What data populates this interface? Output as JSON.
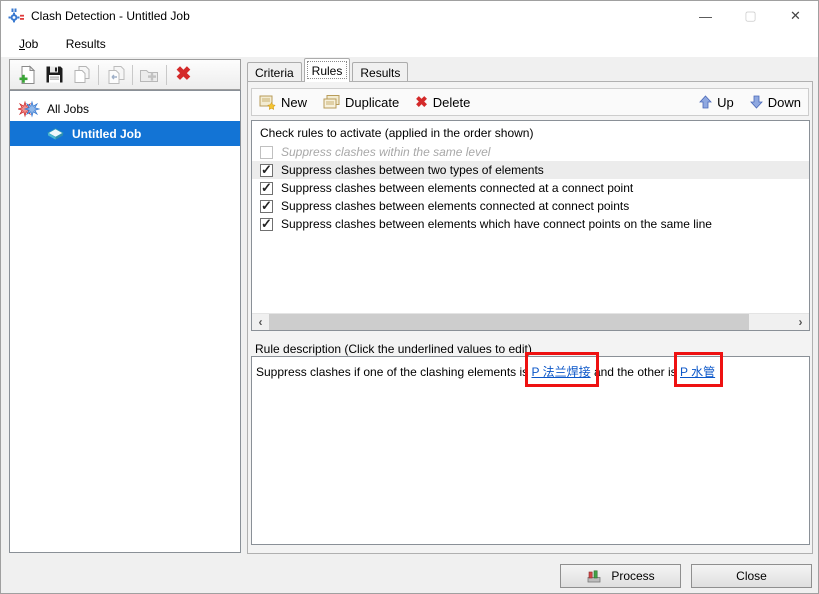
{
  "window": {
    "title": "Clash Detection - Untitled Job",
    "controls": {
      "minimize_glyph": "—",
      "maximize_glyph": "▢",
      "close_glyph": "✕"
    }
  },
  "menu": {
    "items": [
      {
        "label": "Job"
      },
      {
        "label": "Results"
      }
    ]
  },
  "left_toolbar": {
    "icons": [
      "new-job-icon",
      "save-job-icon",
      "copy-job-icon",
      "import-job-icon",
      "add-folder-icon",
      "delete-job-icon"
    ],
    "delete_glyph": "✖"
  },
  "tree": {
    "items": [
      {
        "label": "All Jobs",
        "selected": false
      },
      {
        "label": "Untitled Job",
        "selected": true
      }
    ]
  },
  "tabs": [
    {
      "label": "Criteria",
      "active": false
    },
    {
      "label": "Rules",
      "active": true
    },
    {
      "label": "Results",
      "active": false
    }
  ],
  "rules_toolbar": {
    "new_label": "New",
    "duplicate_label": "Duplicate",
    "delete_label": "Delete",
    "delete_glyph": "✖",
    "up_label": "Up",
    "down_label": "Down"
  },
  "rules_list": {
    "header": "Check rules to activate (applied in the order shown)",
    "rows": [
      {
        "label": "Suppress clashes within the same level",
        "checked": false,
        "enabled": false,
        "selected": false
      },
      {
        "label": "Suppress clashes between two types of elements",
        "checked": true,
        "enabled": true,
        "selected": true
      },
      {
        "label": "Suppress clashes between elements connected at a connect point",
        "checked": true,
        "enabled": true,
        "selected": false
      },
      {
        "label": "Suppress clashes between elements connected at connect points",
        "checked": true,
        "enabled": true,
        "selected": false
      },
      {
        "label": "Suppress clashes between elements which have connect points on the same line",
        "checked": true,
        "enabled": true,
        "selected": false
      }
    ],
    "scroll_left_glyph": "‹",
    "scroll_right_glyph": "›"
  },
  "rule_description": {
    "label": "Rule description (Click the underlined values to edit)",
    "text_part1": "Suppress clashes if one of the clashing elements is ",
    "link1": "P  法兰焊接",
    "text_part2": " and the other is ",
    "link2": "P  水管",
    "annotation_color": "#ee1111"
  },
  "footer": {
    "process_label": "Process",
    "close_label": "Close"
  },
  "colors": {
    "selection_blue": "#1374d5",
    "link_blue": "#0a56c8",
    "annotation_red": "#ee1111",
    "delete_red": "#d42a2a",
    "titlebar_bg": "#ffffff",
    "window_bg": "#f0f0f0"
  }
}
